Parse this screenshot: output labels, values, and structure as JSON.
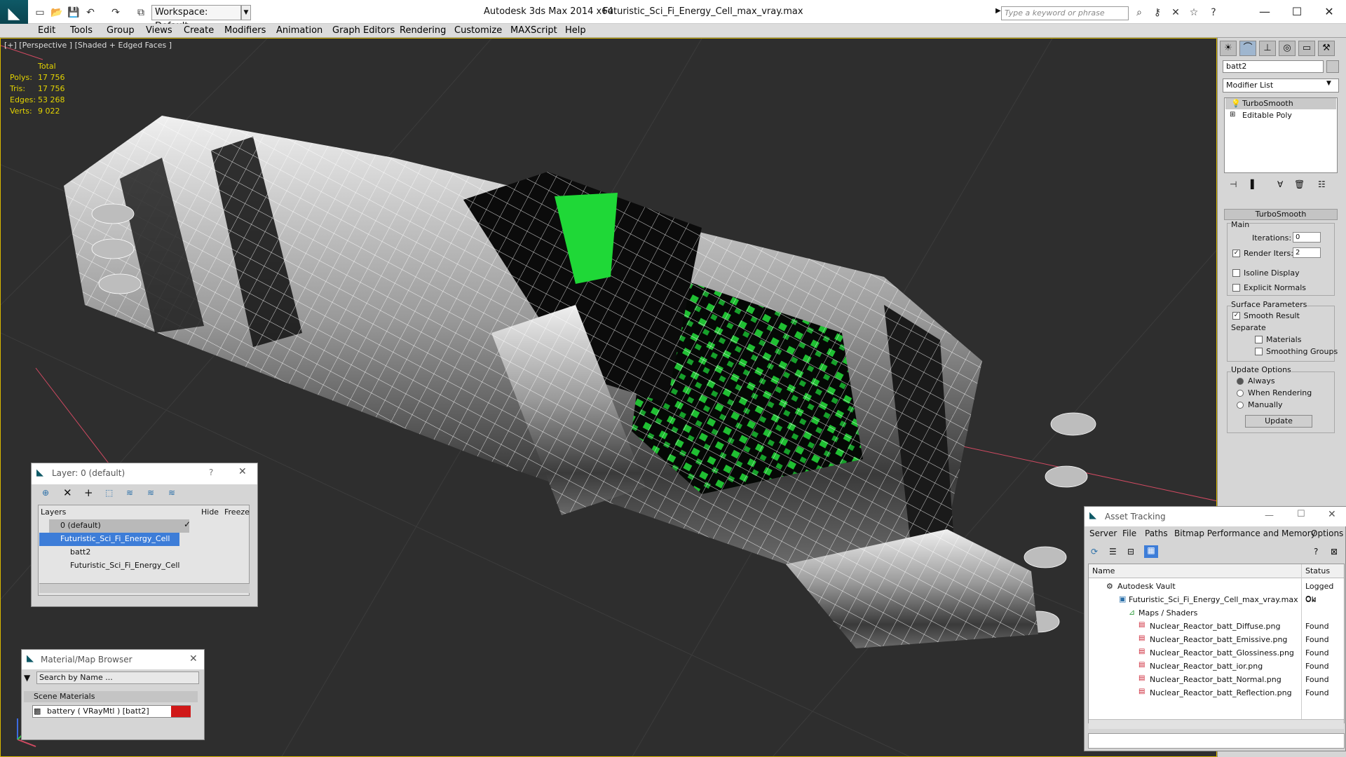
{
  "titlebar": {
    "workspace": "Workspace: Default",
    "app_title": "Autodesk 3ds Max  2014 x64",
    "file_title": "Futuristic_Sci_Fi_Energy_Cell_max_vray.max",
    "search_placeholder": "Type a keyword or phrase"
  },
  "menu": [
    "Edit",
    "Tools",
    "Group",
    "Views",
    "Create",
    "Modifiers",
    "Animation",
    "Graph Editors",
    "Rendering",
    "Customize",
    "MAXScript",
    "Help"
  ],
  "viewport": {
    "label": "[+] [Perspective ] [Shaded + Edged Faces ]",
    "stats": {
      "total_label": "Total",
      "rows": [
        {
          "label": "Polys:",
          "value": "17 756"
        },
        {
          "label": "Tris:",
          "value": "17 756"
        },
        {
          "label": "Edges:",
          "value": "53 268"
        },
        {
          "label": "Verts:",
          "value": "9 022"
        }
      ]
    }
  },
  "command_panel": {
    "object_name": "batt2",
    "modifier_list": "Modifier List",
    "stack": [
      "TurboSmooth",
      "Editable Poly"
    ],
    "rollout_title": "TurboSmooth",
    "main_label": "Main",
    "iterations_label": "Iterations:",
    "iterations_value": "0",
    "render_iters_label": "Render Iters:",
    "render_iters_value": "2",
    "isoline": "Isoline Display",
    "explicit_normals": "Explicit Normals",
    "surface_params": "Surface Parameters",
    "smooth_result": "Smooth Result",
    "separate": "Separate",
    "materials": "Materials",
    "smoothing_groups": "Smoothing Groups",
    "update_options": "Update Options",
    "always": "Always",
    "when_rendering": "When Rendering",
    "manually": "Manually",
    "update_button": "Update"
  },
  "layer_window": {
    "title": "Layer: 0 (default)",
    "help": "?",
    "columns": [
      "Layers",
      "Hide",
      "Freeze"
    ],
    "rows": [
      "0 (default)",
      "Futuristic_Sci_Fi_Energy_Cell",
      "batt2",
      "Futuristic_Sci_Fi_Energy_Cell"
    ]
  },
  "material_browser": {
    "title": "Material/Map Browser",
    "search_placeholder": "Search by Name ...",
    "section": "Scene Materials",
    "item": "battery  ( VRayMtl )  [batt2]"
  },
  "asset_tracking": {
    "title": "Asset Tracking",
    "menu": [
      "Server",
      "File",
      "Paths",
      "Bitmap Performance and Memory",
      "Options"
    ],
    "columns": [
      "Name",
      "Status"
    ],
    "rows": [
      {
        "name": "Autodesk Vault",
        "status": "Logged Ou"
      },
      {
        "name": "Futuristic_Sci_Fi_Energy_Cell_max_vray.max",
        "status": "Ok"
      },
      {
        "name": "Maps / Shaders",
        "status": ""
      },
      {
        "name": "Nuclear_Reactor_batt_Diffuse.png",
        "status": "Found"
      },
      {
        "name": "Nuclear_Reactor_batt_Emissive.png",
        "status": "Found"
      },
      {
        "name": "Nuclear_Reactor_batt_Glossiness.png",
        "status": "Found"
      },
      {
        "name": "Nuclear_Reactor_batt_ior.png",
        "status": "Found"
      },
      {
        "name": "Nuclear_Reactor_batt_Normal.png",
        "status": "Found"
      },
      {
        "name": "Nuclear_Reactor_batt_Reflection.png",
        "status": "Found"
      }
    ]
  },
  "colors": {
    "accent_yellow": "#e3d300",
    "selection_blue": "#3d7dd8",
    "emissive_green": "#22e03a",
    "viewport_bg": "#2e2e2e"
  }
}
